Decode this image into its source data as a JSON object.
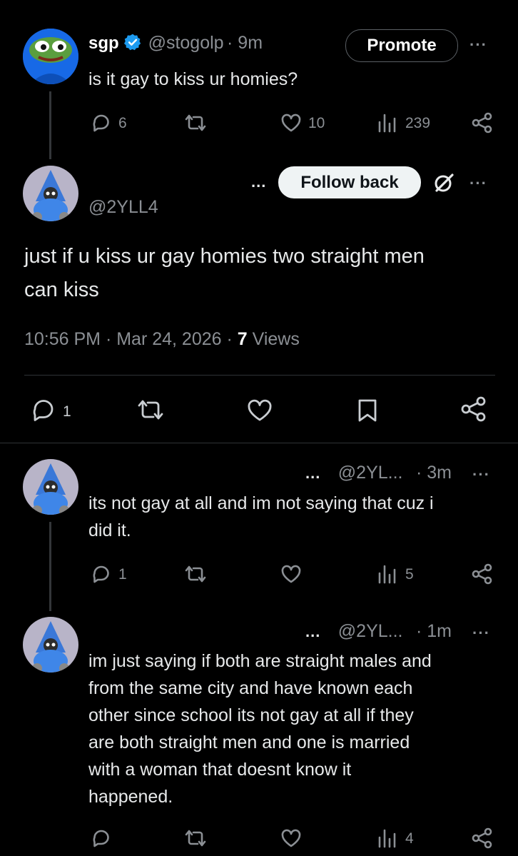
{
  "tweet1": {
    "name": "sgp",
    "handle": "@stogolp",
    "time": "· 9m",
    "promote_label": "Promote",
    "text": "is it gay to kiss ur homies?",
    "replies": "6",
    "likes": "10",
    "views": "239"
  },
  "main": {
    "ellipsis": "...",
    "follow_back_label": "Follow back",
    "handle": "@2YLL4",
    "text_line1": "just if u kiss ur gay homies two straight men",
    "text_line2": "can kiss",
    "timestamp": "10:56 PM · Mar 24, 2026 · ",
    "views_count": "7",
    "views_label": " Views",
    "replies": "1"
  },
  "reply1": {
    "ellipsis": "...",
    "handle": "@2YL...",
    "time": "· 3m",
    "text_line1": "its not gay at all and im not saying that cuz i",
    "text_line2": "did it.",
    "replies": "1",
    "views": "5"
  },
  "reply2": {
    "ellipsis": "...",
    "handle": "@2YL...",
    "time": "· 1m",
    "lines": [
      "im just saying if both are straight males and",
      "from the same city and have known each",
      "other since school its not gay at all if they",
      "are both straight men and one is married",
      "with a woman that doesnt know it",
      "happened."
    ],
    "views": "4"
  },
  "more_glyph": "···",
  "colors": {
    "background": "#000000",
    "verified": "#1d9bf0",
    "muted": "#71767b"
  }
}
